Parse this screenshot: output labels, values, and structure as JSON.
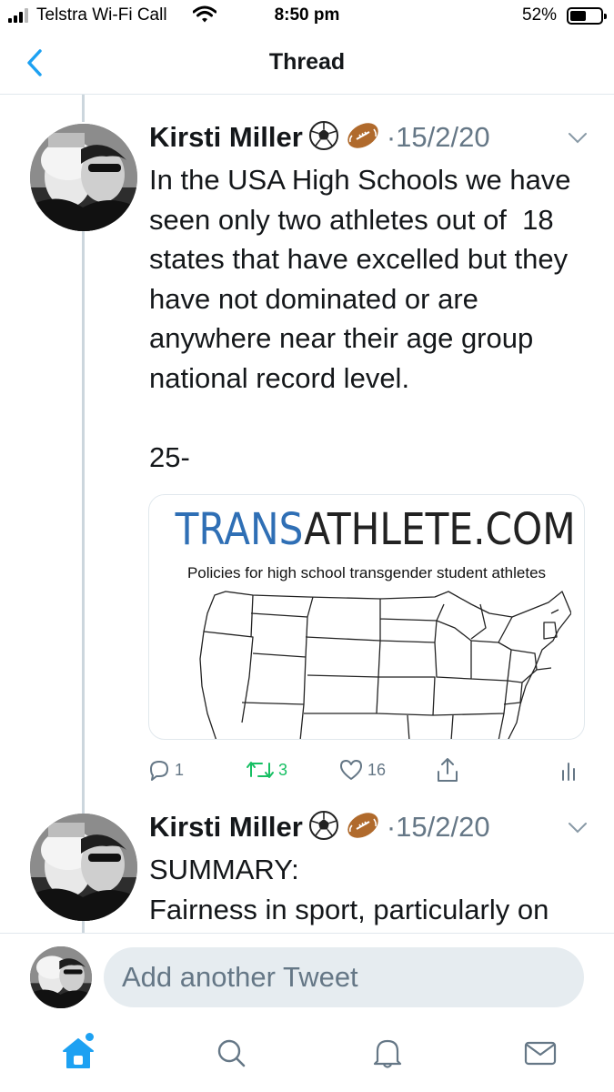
{
  "status_bar": {
    "carrier": "Telstra Wi-Fi Call",
    "time": "8:50 pm",
    "battery_percent": "52%",
    "battery_level": 0.52,
    "signal_icon": "signal-bars-icon",
    "wifi_icon": "wifi-icon"
  },
  "nav": {
    "title": "Thread",
    "back_icon": "chevron-left-icon"
  },
  "colors": {
    "accent": "#1da1f2",
    "retweet_green": "#17bf63",
    "secondary_text": "#657786",
    "divider": "#e1e8ed",
    "compose_bg": "#e6ecf0"
  },
  "tweets": [
    {
      "author": "Kirsti Miller",
      "emojis": [
        "⚽",
        "🏈"
      ],
      "date": "·15/2/20",
      "text": "In the USA High Schools we have seen only two athletes out of  18 states that have excelled but they have not dominated or are anywhere near their age group national record level.\n\n25-",
      "card": {
        "brand_part1": "TRANS",
        "brand_part2": "ATHLETE.COM",
        "subtitle": "Policies for high school transgender student athletes",
        "image": "usa-map-outline"
      },
      "actions": {
        "replies": "1",
        "retweets": "3",
        "likes": "16"
      }
    },
    {
      "author": "Kirsti Miller",
      "emojis": [
        "⚽",
        "🏈"
      ],
      "date": "·15/2/20",
      "text": "SUMMARY:\nFairness in sport, particularly on"
    }
  ],
  "compose": {
    "placeholder": "Add another Tweet"
  },
  "tabbar": {
    "items": [
      "home-icon",
      "search-icon",
      "notifications-icon",
      "messages-icon"
    ],
    "home_has_badge": true
  }
}
